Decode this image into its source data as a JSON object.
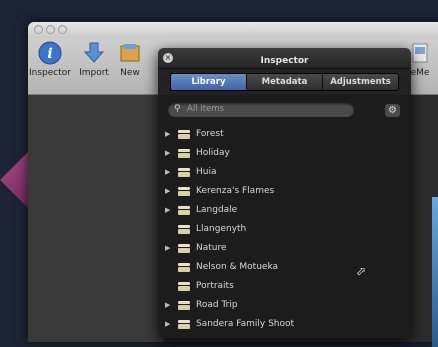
{
  "toolbar": {
    "inspector_label": "Inspector",
    "import_label": "Import",
    "new_label": "New",
    "partial_label": "eMe"
  },
  "inspector": {
    "title": "Inspector",
    "tabs": [
      "Library",
      "Metadata",
      "Adjustments"
    ],
    "active_tab": "Library",
    "search": {
      "placeholder": "All Items"
    },
    "items": [
      {
        "name": "Forest",
        "expandable": true
      },
      {
        "name": "Holiday",
        "expandable": true
      },
      {
        "name": "Huia",
        "expandable": true
      },
      {
        "name": "Kerenza's Flames",
        "expandable": true
      },
      {
        "name": "Langdale",
        "expandable": true
      },
      {
        "name": "Llangenyth",
        "expandable": false
      },
      {
        "name": "Nature",
        "expandable": true
      },
      {
        "name": "Nelson & Motueka",
        "expandable": false
      },
      {
        "name": "Portraits",
        "expandable": false
      },
      {
        "name": "Road Trip",
        "expandable": true
      },
      {
        "name": "Sandera Family Shoot",
        "expandable": true
      }
    ]
  },
  "colors": {
    "tab_active": "#4f76b8",
    "hud_background": "#1c1c1c",
    "project_icon": "#e9e3c5"
  },
  "icons": {
    "inspector": "info-icon",
    "import": "down-arrow-icon",
    "new": "album-icon",
    "search": "magnifier-icon",
    "gear": "gear-icon",
    "disclosure": "triangle-right-icon",
    "project": "project-box-icon"
  }
}
